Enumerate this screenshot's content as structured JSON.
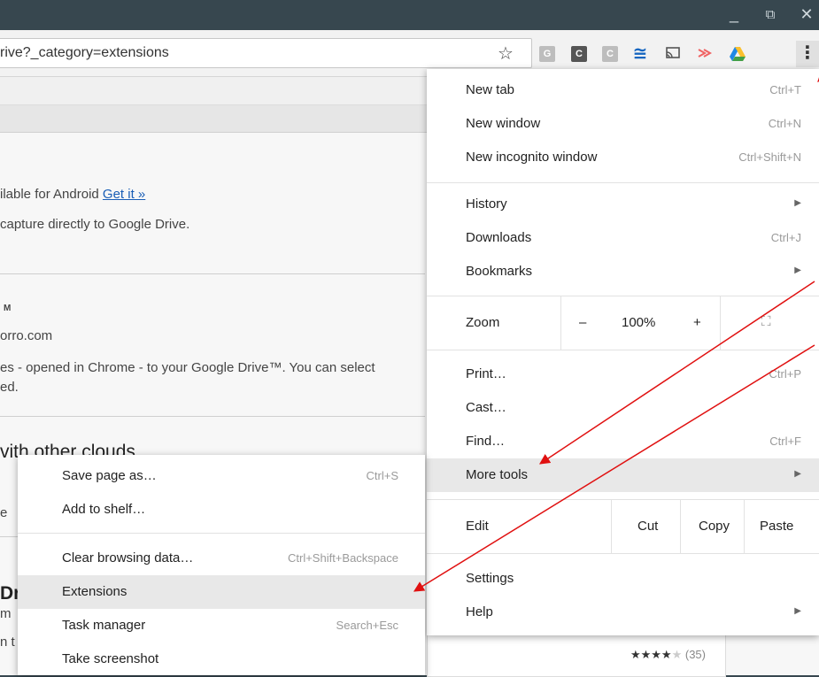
{
  "window_controls": {
    "minimize": "_",
    "restore": "⧉",
    "close": "✕"
  },
  "omnibox": {
    "url": "rive?_category=extensions"
  },
  "toolbar_icons": [
    {
      "name": "extension-g-icon",
      "text": "G",
      "color": "#bdbdbd"
    },
    {
      "name": "extension-c-dark-icon",
      "text": "C",
      "color": "#555555"
    },
    {
      "name": "extension-c-light-icon",
      "text": "C",
      "color": "#bdbdbd"
    }
  ],
  "page": {
    "android_text": "ilable for Android",
    "android_link": "Get it »",
    "capture_text": "capture directly to Google Drive.",
    "tm_text": "M",
    "domain_text": "orro.com",
    "desc_line1": "es - opened in Chrome - to your Google Drive™. You can select",
    "desc_line2": "ed.",
    "clouds_heading": "vith other clouds",
    "frag_e": "e",
    "frag_dr": "Dr",
    "frag_m": "m",
    "frag_t": "n t",
    "rating_stars": "★★★★",
    "rating_empty": "★",
    "rating_count": "(35)"
  },
  "main_menu": {
    "new_tab": {
      "label": "New tab",
      "shortcut": "Ctrl+T"
    },
    "new_window": {
      "label": "New window",
      "shortcut": "Ctrl+N"
    },
    "new_incognito": {
      "label": "New incognito window",
      "shortcut": "Ctrl+Shift+N"
    },
    "history": {
      "label": "History"
    },
    "downloads": {
      "label": "Downloads",
      "shortcut": "Ctrl+J"
    },
    "bookmarks": {
      "label": "Bookmarks"
    },
    "zoom": {
      "label": "Zoom",
      "minus": "–",
      "value": "100%",
      "plus": "+",
      "fullscreen": "⛶"
    },
    "print": {
      "label": "Print…",
      "shortcut": "Ctrl+P"
    },
    "cast": {
      "label": "Cast…"
    },
    "find": {
      "label": "Find…",
      "shortcut": "Ctrl+F"
    },
    "more_tools": {
      "label": "More tools"
    },
    "edit": {
      "label": "Edit",
      "cut": "Cut",
      "copy": "Copy",
      "paste": "Paste"
    },
    "settings": {
      "label": "Settings"
    },
    "help": {
      "label": "Help"
    }
  },
  "submenu": {
    "save_page": {
      "label": "Save page as…",
      "shortcut": "Ctrl+S"
    },
    "add_shelf": {
      "label": "Add to shelf…"
    },
    "clear_data": {
      "label": "Clear browsing data…",
      "shortcut": "Ctrl+Shift+Backspace"
    },
    "extensions": {
      "label": "Extensions"
    },
    "task_manager": {
      "label": "Task manager",
      "shortcut": "Search+Esc"
    },
    "screenshot": {
      "label": "Take screenshot"
    }
  },
  "colors": {
    "annotation": "#e01010",
    "highlight": "#e8e8e8"
  }
}
